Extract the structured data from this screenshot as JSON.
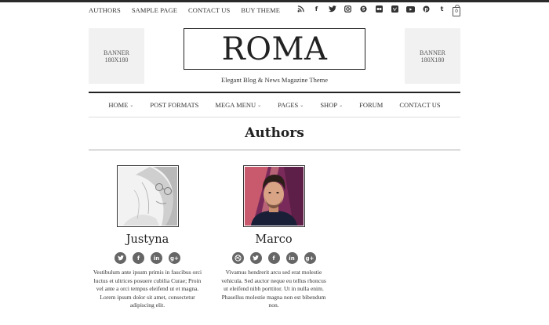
{
  "top_nav": [
    "AUTHORS",
    "SAMPLE PAGE",
    "CONTACT US",
    "BUY THEME"
  ],
  "social_icons": [
    "rss-icon",
    "facebook-icon",
    "twitter-icon",
    "instagram-icon",
    "skype-icon",
    "flickr-icon",
    "vimeo-icon",
    "youtube-icon",
    "pinterest-icon",
    "tumblr-icon"
  ],
  "cart_count": "0",
  "banner_left": {
    "line1": "BANNER",
    "line2": "180X180"
  },
  "banner_right": {
    "line1": "BANNER",
    "line2": "180X180"
  },
  "logo": "ROMA",
  "tagline": "Elegant Blog & News Magazine Theme",
  "main_nav": [
    {
      "label": "HOME",
      "dropdown": true
    },
    {
      "label": "POST FORMATS",
      "dropdown": false
    },
    {
      "label": "MEGA MENU",
      "dropdown": true
    },
    {
      "label": "PAGES",
      "dropdown": true
    },
    {
      "label": "SHOP",
      "dropdown": true
    },
    {
      "label": "FORUM",
      "dropdown": false
    },
    {
      "label": "CONTACT US",
      "dropdown": false
    }
  ],
  "page_title": "Authors",
  "authors": [
    {
      "name": "Justyna",
      "icons": [
        "twitter-icon",
        "facebook-icon",
        "linkedin-icon",
        "google-plus-icon"
      ],
      "bio": "Vestibulum ante ipsum primis in faucibus orci luctus et ultrices posuere cubilia Curae; Proin vel ante a orci tempus eleifend ut et magna. Lorem ipsum dolor sit amet, consectetur adipiscing elit."
    },
    {
      "name": "Marco",
      "icons": [
        "dribbble-icon",
        "twitter-icon",
        "facebook-icon",
        "linkedin-icon",
        "google-plus-icon"
      ],
      "bio": "Vivamus hendrerit arcu sed erat molestie vehicula. Sed auctor neque eu tellus rhoncus ut eleifend nibh porttitor. Ut in nulla enim. Phasellus molestie magna non est bibendum non."
    }
  ]
}
